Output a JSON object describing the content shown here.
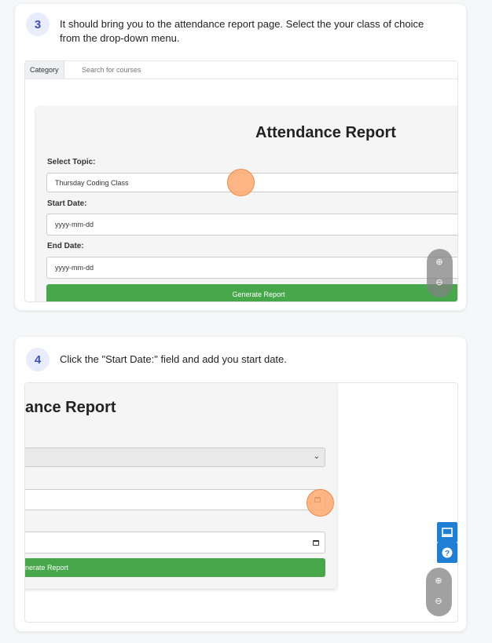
{
  "step3": {
    "number": "3",
    "text": "It should bring you to the attendance report page. Select the your class of choice from the drop-down menu.",
    "tab_category": "Category",
    "search_placeholder": "Search for courses",
    "report_title": "Attendance Report",
    "select_topic_label": "Select Topic:",
    "topic_value": "Thursday Coding Class",
    "start_date_label": "Start Date:",
    "start_date_value": "yyyy-mm-dd",
    "end_date_label": "End Date:",
    "end_date_value": "yyyy-mm-dd",
    "generate_label": "Generate Report"
  },
  "step4": {
    "number": "4",
    "text": "Click the \"Start Date:\" field and add you start date.",
    "report_title_partial": "ance Report",
    "generate_label_partial": "nerate Report"
  },
  "icons": {
    "zoom_in": "zoom-in-icon",
    "zoom_out": "zoom-out-icon",
    "monitor": "monitor-icon",
    "help": "help-icon",
    "calendar": "calendar-icon",
    "dropdown": "chevron-down-icon"
  },
  "colors": {
    "accent_blue": "#3d4fc4",
    "green_button": "#46a84a",
    "click_marker": "#f5a26b",
    "side_button": "#1e7fd4"
  }
}
